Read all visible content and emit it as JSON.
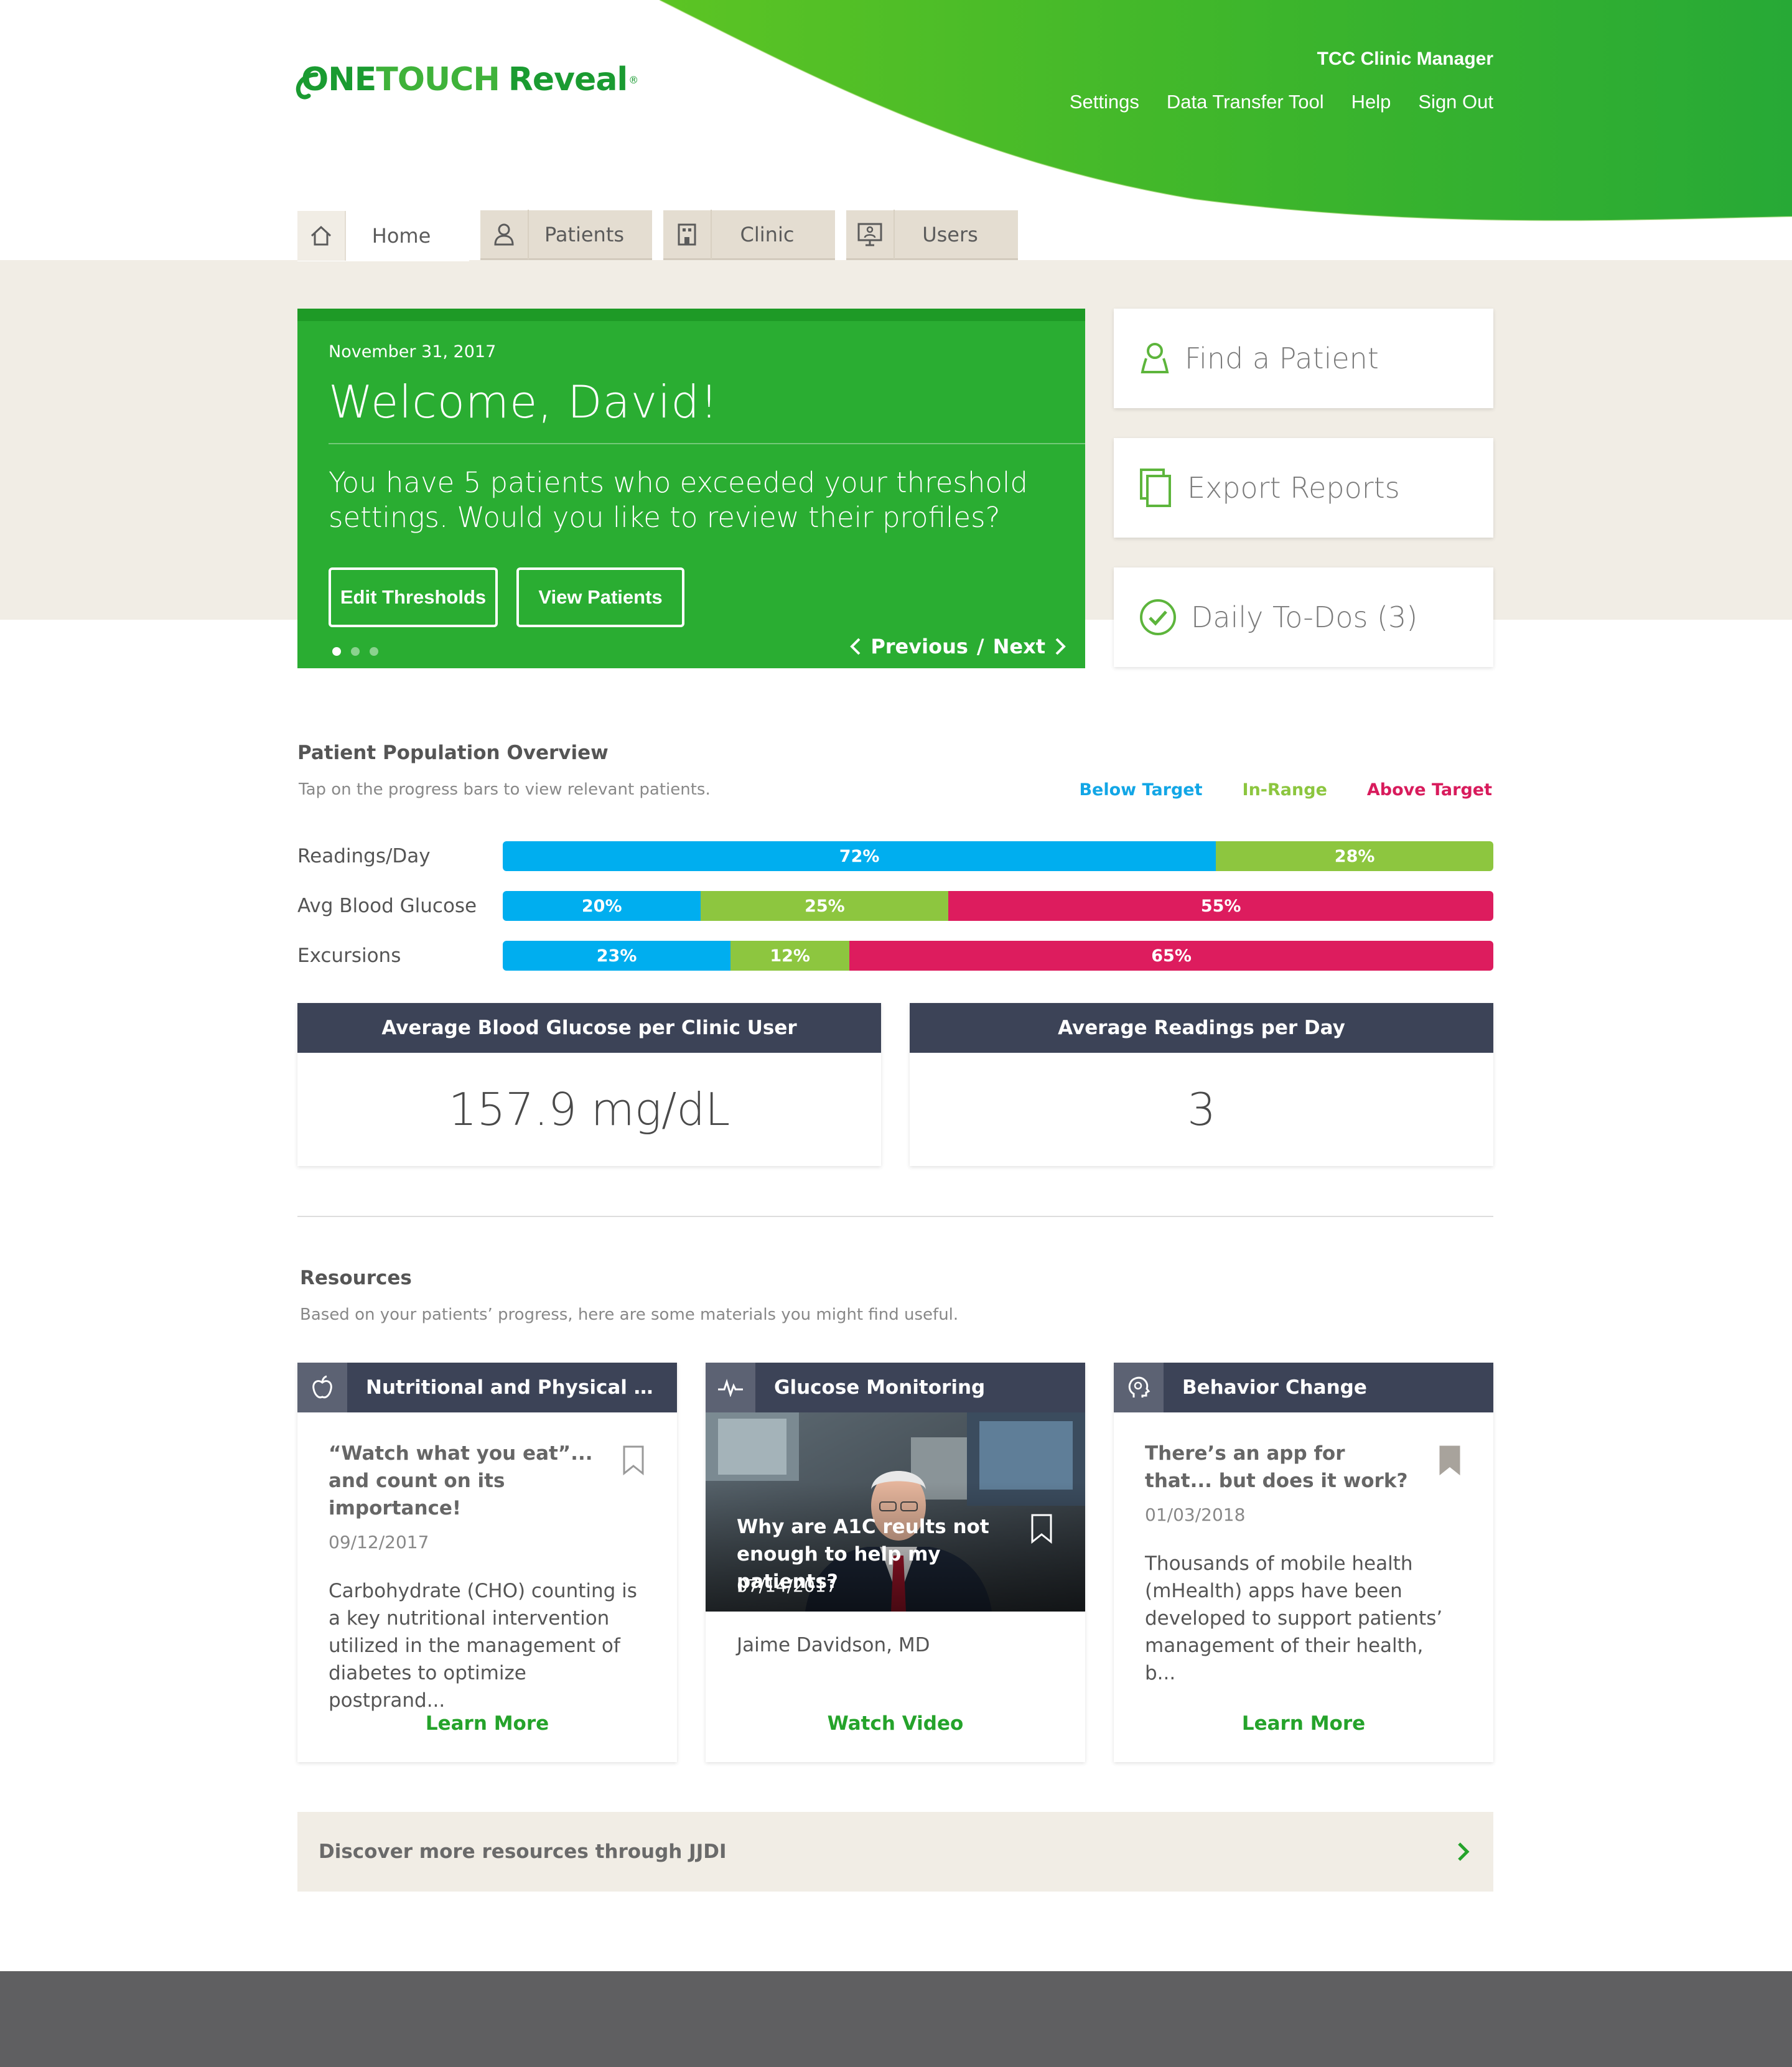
{
  "brand": {
    "one": "ONE",
    "touch": "TOUCH",
    "reveal": "Reveal",
    "reg": "®",
    "green": "#2aad32",
    "dark_green": "#1a9b31"
  },
  "header": {
    "clinic_name": "TCC Clinic Manager",
    "nav": [
      "Settings",
      "Data Transfer Tool",
      "Help",
      "Sign Out"
    ]
  },
  "tabs": [
    {
      "label": "Home",
      "icon": "home-icon",
      "active": true
    },
    {
      "label": "Patients",
      "icon": "user-icon",
      "active": false
    },
    {
      "label": "Clinic",
      "icon": "building-icon",
      "active": false
    },
    {
      "label": "Users",
      "icon": "monitor-user-icon",
      "active": false
    }
  ],
  "welcome": {
    "date": "November 31, 2017",
    "title": "Welcome, David!",
    "message": "You have 5 patients who exceeded your threshold settings. Would you like to review their profiles?",
    "edit_thresholds": "Edit Thresholds",
    "view_patients": "View Patients",
    "previous": "Previous",
    "separator": "/",
    "next": "Next",
    "dots": 3,
    "active_dot": 0
  },
  "actions": {
    "find_patient": "Find a Patient",
    "export_reports": "Export Reports",
    "daily_todos": "Daily To-Dos (3)"
  },
  "overview": {
    "title": "Patient Population Overview",
    "hint": "Tap on the progress bars to view relevant patients.",
    "legend": {
      "below": "Below Target",
      "inrange": "In-Range",
      "above": "Above Target"
    },
    "colors": {
      "below": "#00aeef",
      "inrange": "#8dc63f",
      "above": "#dd1c5e"
    },
    "rows": [
      {
        "label": "Readings/Day",
        "below": 72,
        "inrange": 28,
        "above": 0
      },
      {
        "label": "Avg Blood Glucose",
        "below": 20,
        "inrange": 25,
        "above": 55
      },
      {
        "label": "Excursions",
        "below": 23,
        "inrange": 12,
        "above": 65
      }
    ]
  },
  "stats": {
    "glucose_head": "Average Blood Glucose per Clinic User",
    "glucose_value": "157.9 mg/dL",
    "readings_head": "Average Readings per Day",
    "readings_value": "3"
  },
  "resources": {
    "title": "Resources",
    "hint": "Based on your patients’ progress, here are some materials you might find useful.",
    "nutrition": {
      "category": "Nutritional and Physical Activ...",
      "title": "“Watch what you eat”... and count on its importance!",
      "date": "09/12/2017",
      "desc": "Carbohydrate (CHO) counting is a key nutritional intervention utilized in the management of diabetes to optimize postprand...",
      "cta": "Learn More"
    },
    "glucose": {
      "category": "Glucose Monitoring",
      "title": "Why are A1C reults not enough to help my patients?",
      "date": "07/14/2017",
      "author": "Jaime Davidson, MD",
      "cta": "Watch Video"
    },
    "behavior": {
      "category": "Behavior Change",
      "title": "There’s an app for that... but does it work?",
      "date": "01/03/2018",
      "desc": "Thousands of mobile health (mHealth) apps have been developed to support patients’ management of their health, b...",
      "cta": "Learn More"
    },
    "discover": "Discover more resources through JJDI"
  }
}
